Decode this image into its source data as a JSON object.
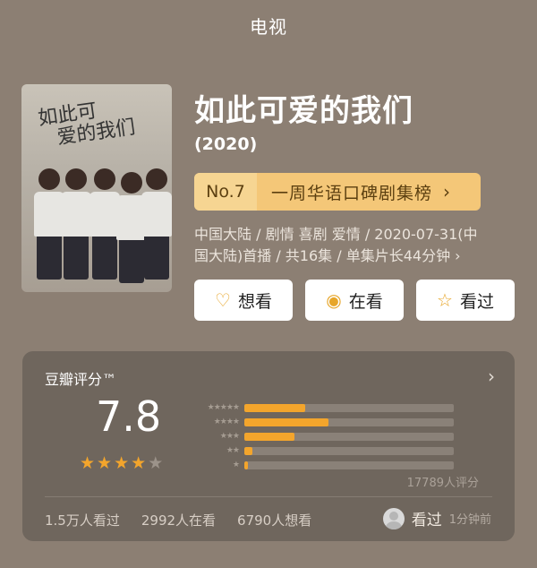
{
  "header": {
    "title": "电视"
  },
  "poster": {
    "scribble_line1": "如此可",
    "scribble_line2": "爱的我们"
  },
  "show": {
    "title": "如此可爱的我们",
    "year": "(2020)",
    "rank": {
      "no": "No.7",
      "text": "一周华语口碑剧集榜",
      "chevron": "›"
    },
    "meta_line1": "中国大陆 / 剧情 喜剧 爱情 / 2020-07-31(中",
    "meta_line2": "国大陆)首播 / 共16集 / 单集片长44分钟 ›"
  },
  "actions": {
    "want": {
      "icon": "heart-plus-icon",
      "label": "想看"
    },
    "watching": {
      "icon": "target-icon",
      "label": "在看"
    },
    "watched": {
      "icon": "star-outline-icon",
      "label": "看过"
    }
  },
  "rating": {
    "title": "豆瓣评分™",
    "score": "7.8",
    "stars_filled": 4,
    "stars_total": 5,
    "distribution": [
      {
        "stars": "★★★★★",
        "fraction": 0.29
      },
      {
        "stars": "★★★★",
        "fraction": 0.4
      },
      {
        "stars": "★★★",
        "fraction": 0.24
      },
      {
        "stars": "★★",
        "fraction": 0.04
      },
      {
        "stars": "★",
        "fraction": 0.015
      }
    ],
    "votes": "17789人评分",
    "stats": [
      "1.5万人看过",
      "2992人在看",
      "6790人想看"
    ],
    "me_label": "看过",
    "me_time": "1分钟前"
  },
  "colors": {
    "accent": "#f3a52c",
    "rank_bg": "#f4c778",
    "card_bg": "#6f665d",
    "page_bg": "#8c7f73"
  }
}
